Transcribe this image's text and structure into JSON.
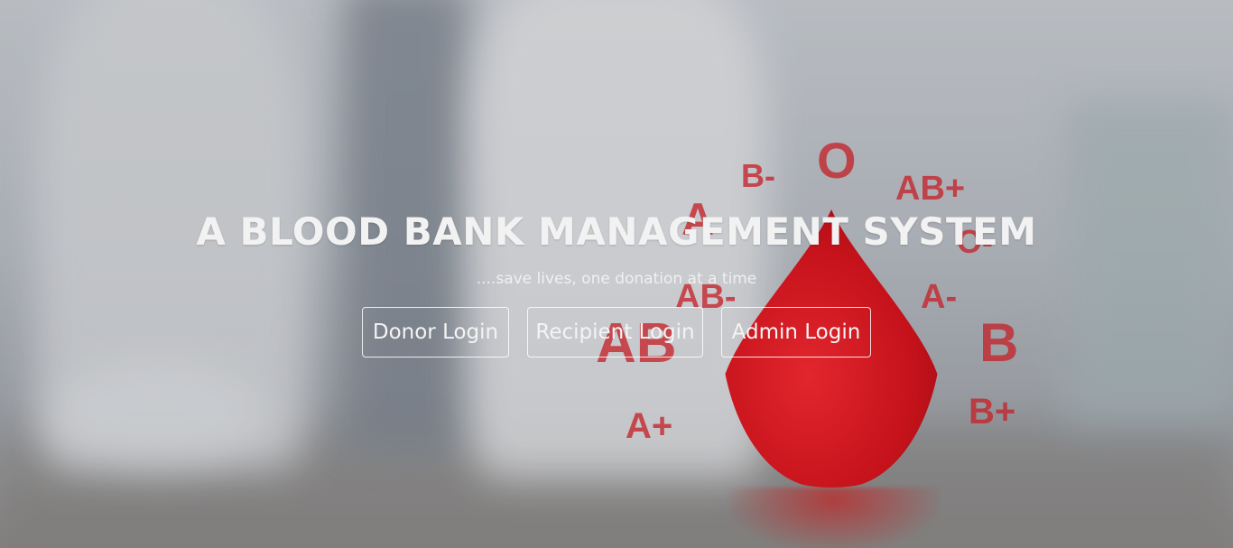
{
  "hero": {
    "title": "A BLOOD BANK MANAGEMENT SYSTEM",
    "tagline": "....save lives, one donation at a time"
  },
  "buttons": {
    "donor": "Donor Login",
    "recipient": "Recipient Login",
    "admin": "Admin Login"
  },
  "background": {
    "blood_types": [
      "O",
      "B-",
      "AB+",
      "A",
      "O-",
      "AB-",
      "A-",
      "AB",
      "B",
      "A+",
      "B+"
    ],
    "accent_color": "#c4242b",
    "drop_color": "#d21c24"
  }
}
